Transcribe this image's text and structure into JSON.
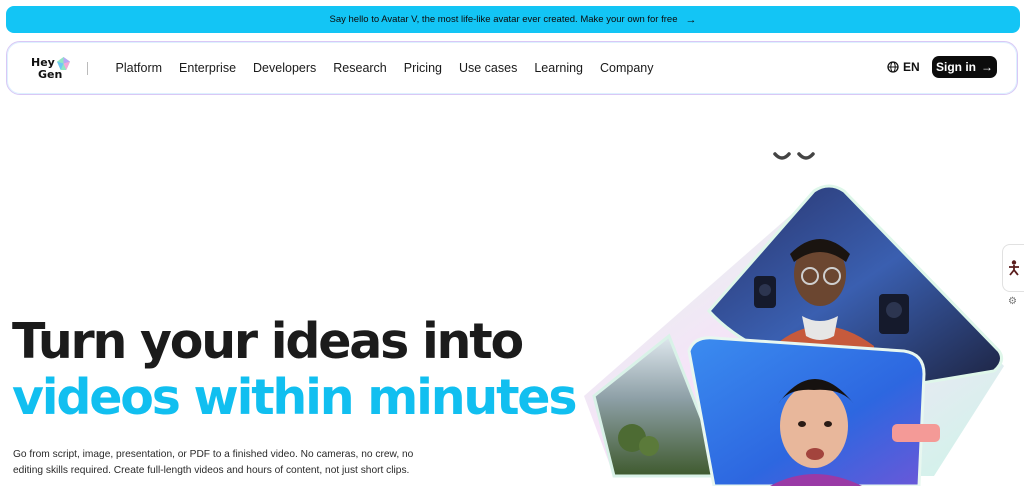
{
  "announcement": {
    "text": "Say hello to Avatar V, the most life-like avatar ever created. Make your own for free",
    "arrow": "→"
  },
  "nav": {
    "logo_line1": "Hey",
    "logo_line2": "Gen",
    "items": [
      "Platform",
      "Enterprise",
      "Developers",
      "Research",
      "Pricing",
      "Use cases",
      "Learning",
      "Company"
    ],
    "language": "EN",
    "sign_in": "Sign in",
    "sign_in_arrow": "→"
  },
  "hero": {
    "title_line1": "Turn your ideas into",
    "title_line2": "videos within minutes",
    "description": "Go from script, image, presentation, or PDF to a finished video. No cameras, no crew, no editing skills required. Create full-length videos and hours of content, not just short clips."
  },
  "colors": {
    "announcement_bg": "#13c5f5",
    "accent_cyan": "#11bff0",
    "button_dark": "#0c0c0c"
  },
  "icons": [
    "globe-icon",
    "arrow-right-icon",
    "heygen-gem-icon",
    "gear-icon",
    "person-icon"
  ]
}
